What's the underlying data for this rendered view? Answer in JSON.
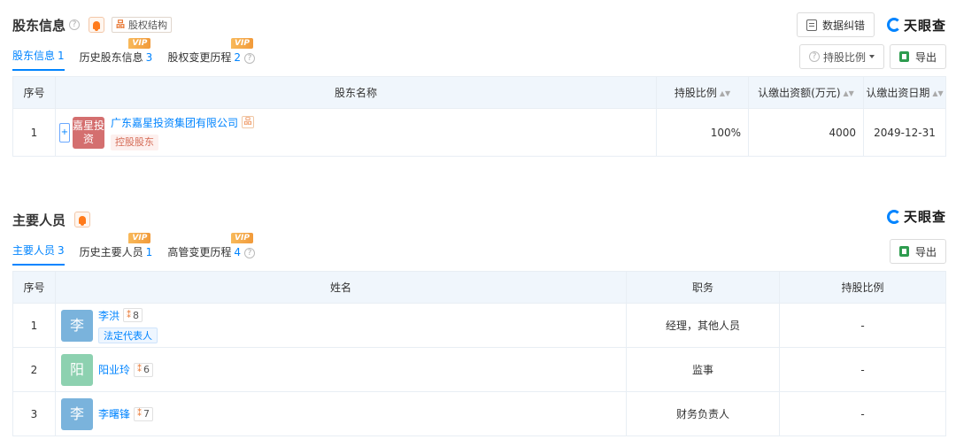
{
  "shareholders": {
    "title": "股东信息",
    "help_glyph": "?",
    "equity_link": "股权结构",
    "correction_btn": "数据纠错",
    "brand": "天眼查",
    "tabs": [
      {
        "label": "股东信息",
        "count": "1",
        "active": true,
        "vip": ""
      },
      {
        "label": "历史股东信息",
        "count": "3",
        "active": false,
        "vip": "VIP"
      },
      {
        "label": "股权变更历程",
        "count": "2",
        "active": false,
        "vip": "VIP"
      }
    ],
    "ratio_btn": "持股比例",
    "export_btn": "导出",
    "columns": [
      "序号",
      "股东名称",
      "持股比例",
      "认缴出资额(万元)",
      "认缴出资日期"
    ],
    "rows": [
      {
        "index": "1",
        "logo_text": "嘉星投资",
        "name": "广东嘉星投资集团有限公司",
        "tag": "控股股东",
        "ratio": "100%",
        "amount": "4000",
        "date": "2049-12-31"
      }
    ]
  },
  "staff": {
    "title": "主要人员",
    "brand": "天眼查",
    "tabs": [
      {
        "label": "主要人员",
        "count": "3",
        "active": true,
        "vip": ""
      },
      {
        "label": "历史主要人员",
        "count": "1",
        "active": false,
        "vip": "VIP"
      },
      {
        "label": "高管变更历程",
        "count": "4",
        "active": false,
        "vip": "VIP"
      }
    ],
    "export_btn": "导出",
    "columns": [
      "序号",
      "姓名",
      "职务",
      "持股比例"
    ],
    "rows": [
      {
        "index": "1",
        "avatar": "李",
        "avatar_color": "#7ab3dc",
        "name": "李洪",
        "rel_count": "8",
        "tag": "法定代表人",
        "role": "经理，其他人员",
        "ratio": "-"
      },
      {
        "index": "2",
        "avatar": "阳",
        "avatar_color": "#8dd1b0",
        "name": "阳业玲",
        "rel_count": "6",
        "tag": "",
        "role": "监事",
        "ratio": "-"
      },
      {
        "index": "3",
        "avatar": "李",
        "avatar_color": "#7ab3dc",
        "name": "李曙锋",
        "rel_count": "7",
        "tag": "",
        "role": "财务负责人",
        "ratio": "-"
      }
    ]
  },
  "colors": {
    "accent": "#0084ff",
    "header_bg": "#f0f6fc",
    "vip": "#f19a3a",
    "control_tag": "#d56c57"
  }
}
